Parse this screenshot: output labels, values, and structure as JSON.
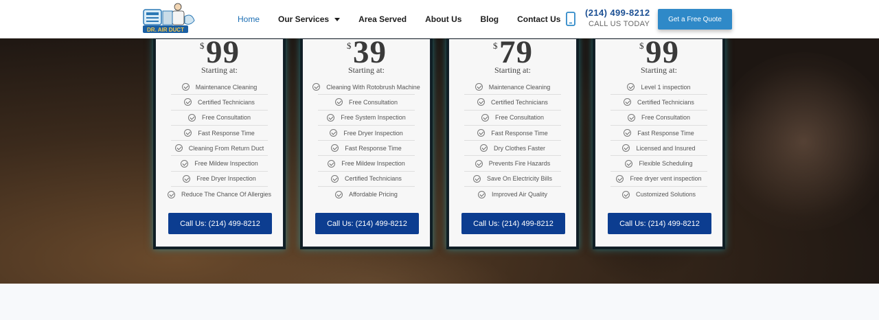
{
  "header": {
    "logo_text": "DR. AIR DUCT",
    "nav": [
      {
        "label": "Home",
        "active": true
      },
      {
        "label": "Our Services",
        "dropdown": true
      },
      {
        "label": "Area Served"
      },
      {
        "label": "About Us"
      },
      {
        "label": "Blog"
      },
      {
        "label": "Contact Us"
      }
    ],
    "phone_icon": "mobile-phone-icon",
    "phone_number": "(214) 499-8212",
    "phone_sub": "CALL US TODAY",
    "quote_button": "Get a Free Quote"
  },
  "cards": [
    {
      "currency": "$",
      "price": "99",
      "starting": "Starting at:",
      "features": [
        "Maintenance Cleaning",
        "Certified Technicians",
        "Free Consultation",
        "Fast Response Time",
        "Cleaning From Return Duct",
        "Free Mildew Inspection",
        "Free Dryer Inspection",
        "Reduce The Chance Of Allergies"
      ],
      "button": "Call Us: (214) 499-8212"
    },
    {
      "currency": "$",
      "price": "39",
      "starting": "Starting at:",
      "features": [
        "Cleaning With Rotobrush Machine",
        "Free Consultation",
        "Free System Inspection",
        "Free Dryer Inspection",
        "Fast Response Time",
        "Free Mildew Inspection",
        "Certified Technicians",
        "Affordable Pricing"
      ],
      "button": "Call Us: (214) 499-8212"
    },
    {
      "currency": "$",
      "price": "79",
      "starting": "Starting at:",
      "features": [
        "Maintenance Cleaning",
        "Certified Technicians",
        "Free Consultation",
        "Fast Response Time",
        "Dry Clothes Faster",
        "Prevents Fire Hazards",
        "Save On Electricity Bills",
        "Improved Air Quality"
      ],
      "button": "Call Us: (214) 499-8212"
    },
    {
      "currency": "$",
      "price": "99",
      "starting": "Starting at:",
      "features": [
        "Level 1 inspection",
        "Certified Technicians",
        "Free Consultation",
        "Fast Response Time",
        "Licensed and Insured",
        "Flexible Scheduling",
        "Free dryer vent inspection",
        "Customized Solutions"
      ],
      "button": "Call Us: (214) 499-8212"
    }
  ],
  "colors": {
    "accent": "#1a6db3",
    "phone": "#1b4f93",
    "quote_button": "#2f89c8",
    "call_button": "#0c3d90",
    "card_glow": "#20aabe"
  }
}
